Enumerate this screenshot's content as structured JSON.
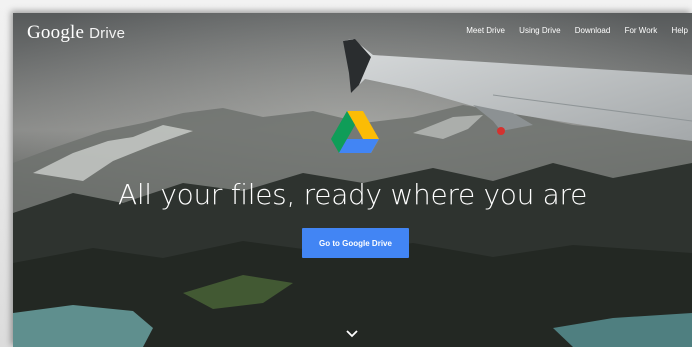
{
  "header": {
    "logo_google": "Google",
    "logo_product": "Drive",
    "nav": [
      "Meet Drive",
      "Using Drive",
      "Download",
      "For Work",
      "Help"
    ]
  },
  "hero": {
    "headline": "All your files, ready where you are",
    "cta_label": "Go to Google Drive",
    "scroll_icon": "chevron-down-icon",
    "logo_icon": "google-drive-icon"
  },
  "colors": {
    "cta": "#4285f4",
    "drive_green": "#0f9d58",
    "drive_yellow": "#fbbc05",
    "drive_blue": "#4285f4"
  }
}
